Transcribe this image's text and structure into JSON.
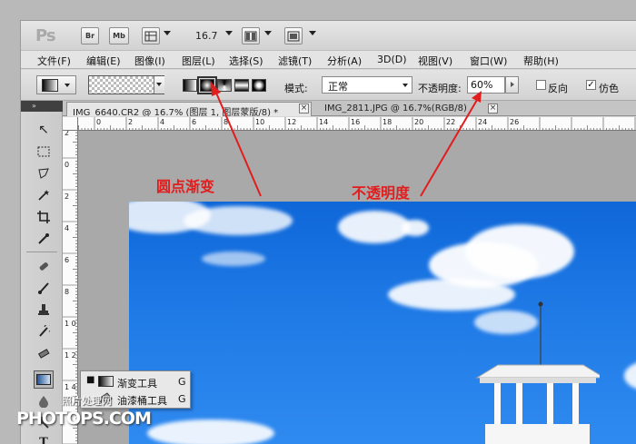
{
  "titlebar": {
    "logo": "Ps",
    "bridge_label": "Br",
    "minibridge_label": "Mb",
    "zoom_value": "16.7"
  },
  "menubar": {
    "items": [
      {
        "label": "文件(F)"
      },
      {
        "label": "编辑(E)"
      },
      {
        "label": "图像(I)"
      },
      {
        "label": "图层(L)"
      },
      {
        "label": "选择(S)"
      },
      {
        "label": "滤镜(T)"
      },
      {
        "label": "分析(A)"
      },
      {
        "label": "3D(D)"
      },
      {
        "label": "视图(V)"
      },
      {
        "label": "窗口(W)"
      },
      {
        "label": "帮助(H)"
      }
    ]
  },
  "options": {
    "mode_label": "模式:",
    "mode_value": "正常",
    "opacity_label": "不透明度:",
    "opacity_value": "60%",
    "reverse_label": "反向",
    "reverse_checked": false,
    "dither_label": "仿色",
    "dither_checked": true,
    "gradient_types": [
      "linear-gradient-icon",
      "radial-gradient-icon",
      "angle-gradient-icon",
      "reflected-gradient-icon",
      "diamond-gradient-icon"
    ],
    "active_gradient_type": "radial-gradient-icon"
  },
  "tabs": [
    {
      "label": "IMG_6640.CR2 @ 16.7% (图层 1, 图层蒙版/8) *",
      "active": true
    },
    {
      "label": "IMG_2811.JPG @ 16.7%(RGB/8)",
      "active": false
    }
  ],
  "ruler": {
    "h_ticks": [
      "2",
      "0",
      "2",
      "4",
      "6",
      "8",
      "10",
      "12",
      "14",
      "16",
      "18",
      "20",
      "22",
      "24",
      "26"
    ],
    "v_ticks": [
      "2",
      "0",
      "2",
      "4",
      "6",
      "8",
      "1 0",
      "1 2",
      "1 4"
    ]
  },
  "flyout": {
    "items": [
      {
        "label": "渐变工具",
        "shortcut": "G",
        "icon": "gradient-tool-icon",
        "selected": true
      },
      {
        "label": "油漆桶工具",
        "shortcut": "G",
        "icon": "paint-bucket-icon",
        "selected": false
      }
    ]
  },
  "annotations": {
    "radial": "圆点渐变",
    "opacity": "不透明度"
  },
  "watermark": {
    "line1": "照片处理网",
    "line2": "PHOTOPS.COM"
  },
  "colors": {
    "annotation_red": "#e21d1d",
    "sky_blue": "#1f7ae6"
  }
}
